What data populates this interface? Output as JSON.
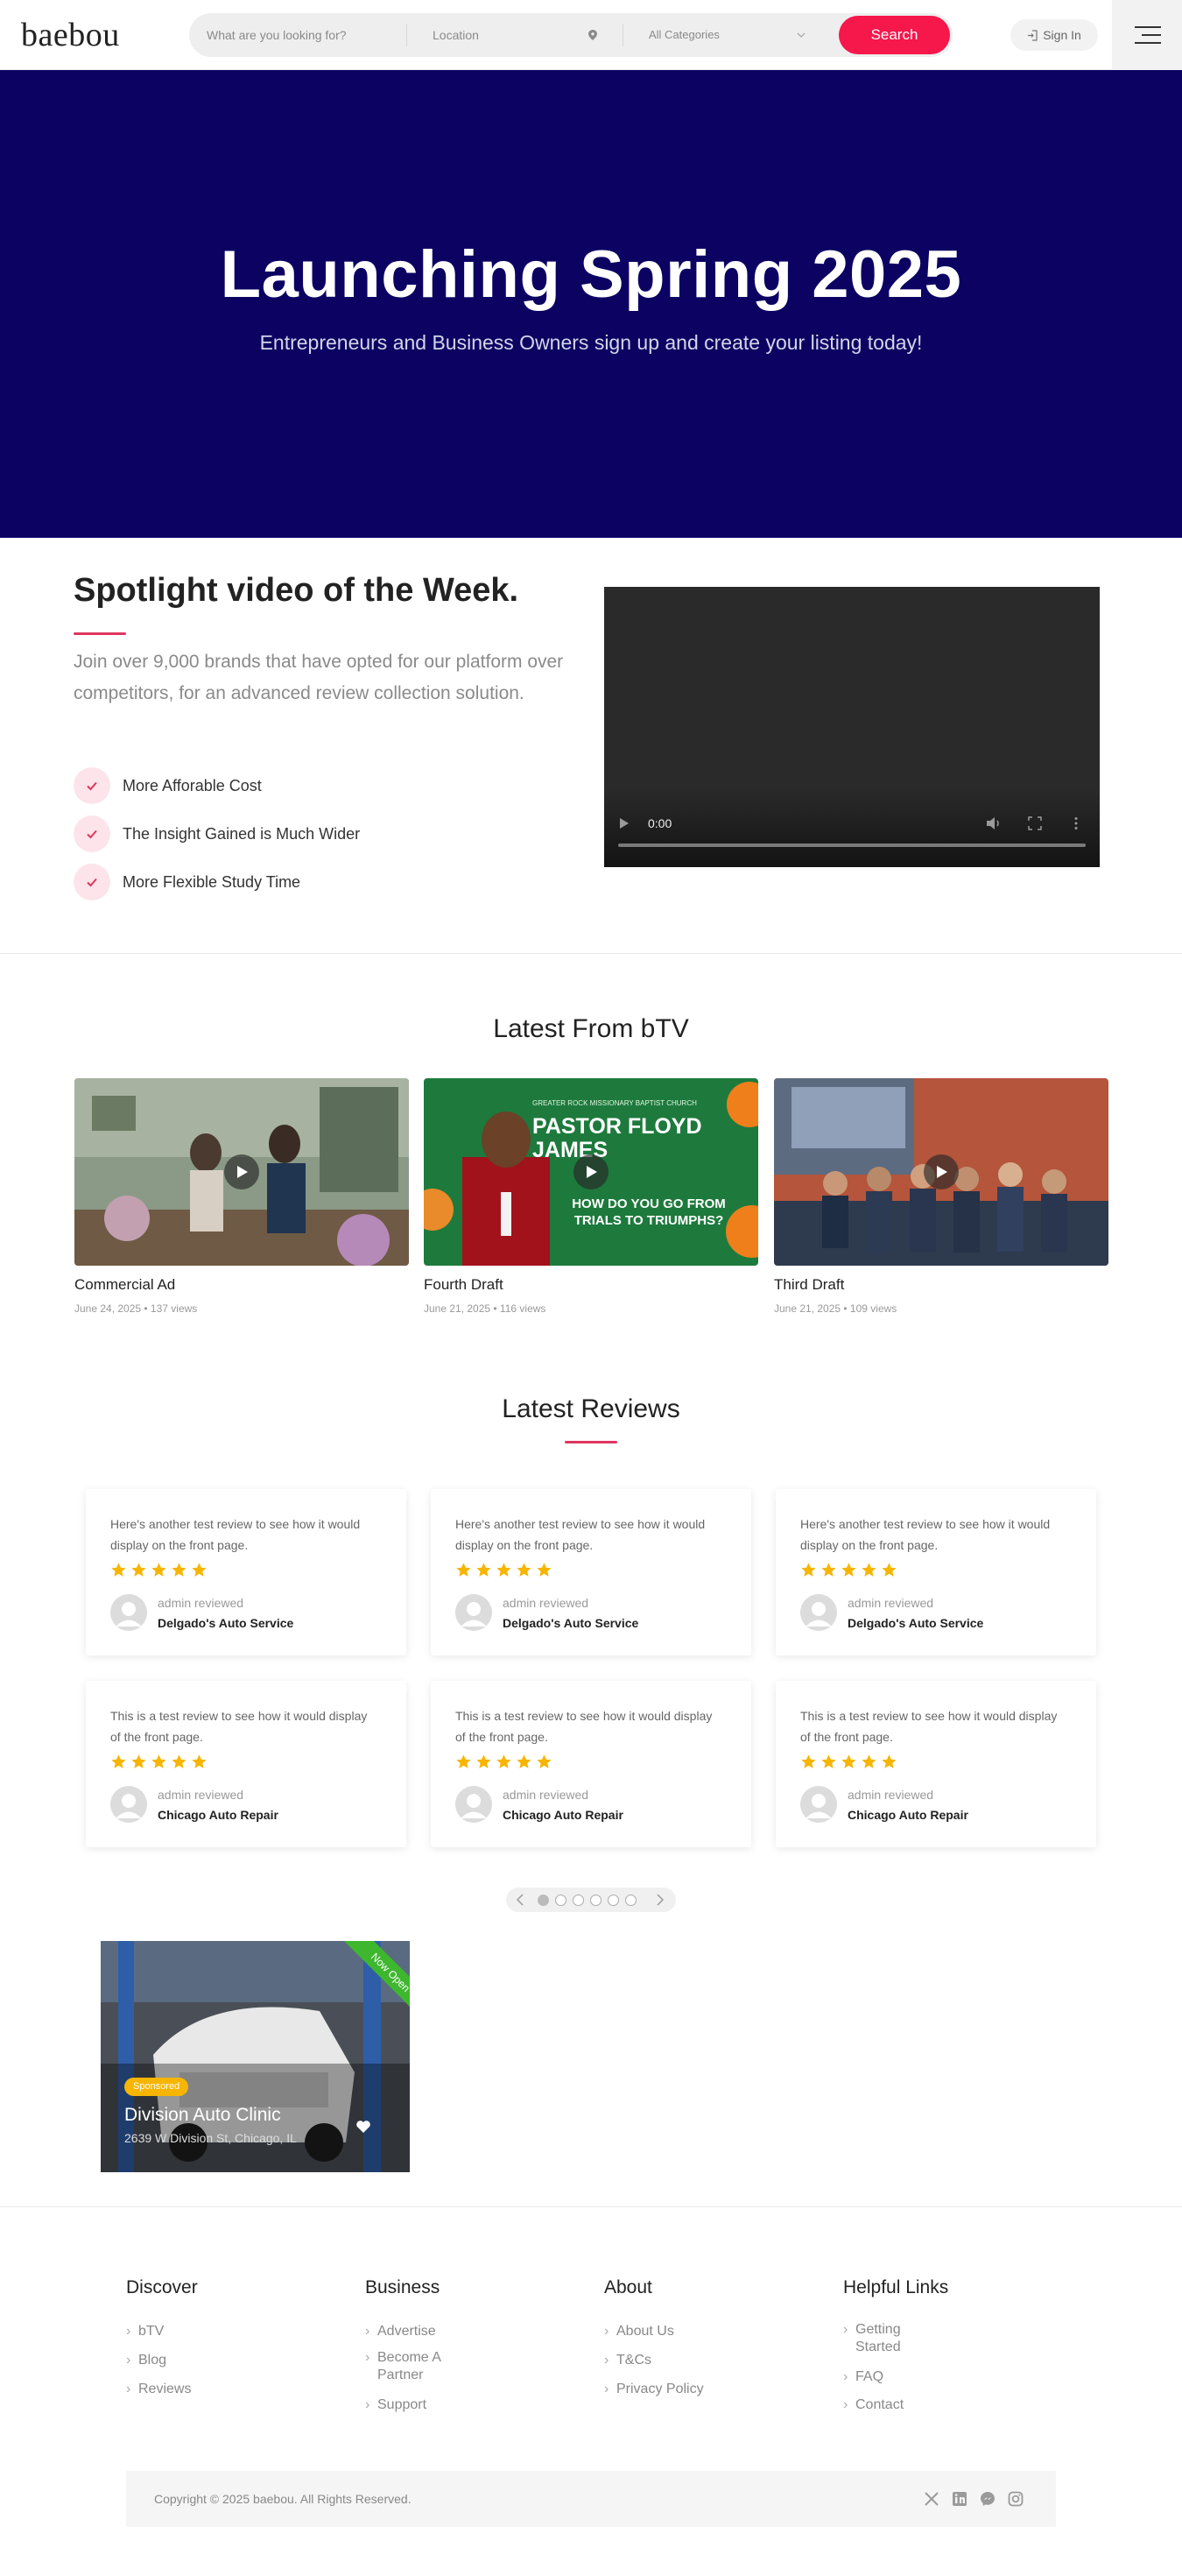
{
  "header": {
    "logo": "baebou",
    "search_placeholder": "What are you looking for?",
    "location_placeholder": "Location",
    "category_selected": "All Categories",
    "search_label": "Search",
    "signin_label": "Sign In"
  },
  "hero": {
    "title": "Launching Spring 2025",
    "subtitle": "Entrepreneurs and Business Owners sign up and create your listing today!",
    "background": "#0b0262"
  },
  "spotlight": {
    "title": "Spotlight video of the Week.",
    "description": "Join over 9,000 brands that have opted for our platform over competitors, for an advanced review collection solution.",
    "features": [
      "More Afforable Cost",
      "The Insight Gained is Much Wider",
      "More Flexible Study Time"
    ],
    "video_time": "0:00"
  },
  "btv": {
    "title": "Latest From bTV",
    "videos": [
      {
        "title": "Commercial Ad",
        "meta": "June 24, 2025 • 137 views"
      },
      {
        "title": "Fourth Draft",
        "meta": "June 21, 2025 • 116 views",
        "thumb_caption_top": "GREATER ROCK MISSIONARY BAPTIST CHURCH",
        "thumb_caption_name": "PASTOR FLOYD JAMES",
        "thumb_caption_bottom": "HOW DO YOU GO FROM TRIALS TO TRIUMPHS?"
      },
      {
        "title": "Third Draft",
        "meta": "June 21, 2025 • 109 views"
      }
    ]
  },
  "reviews": {
    "title": "Latest Reviews",
    "items": [
      {
        "text": "Here's another test review to see how it would display on the front page.",
        "by": "admin reviewed",
        "business": "Delgado's Auto Service",
        "rating": 5
      },
      {
        "text": "Here's another test review to see how it would display on the front page.",
        "by": "admin reviewed",
        "business": "Delgado's Auto Service",
        "rating": 5
      },
      {
        "text": "Here's another test review to see how it would display on the front page.",
        "by": "admin reviewed",
        "business": "Delgado's Auto Service",
        "rating": 5
      },
      {
        "text": "This is a test review to see how it would display of the front page.",
        "by": "admin reviewed",
        "business": "Chicago Auto Repair",
        "rating": 5
      },
      {
        "text": "This is a test review to see how it would display of the front page.",
        "by": "admin reviewed",
        "business": "Chicago Auto Repair",
        "rating": 5
      },
      {
        "text": "This is a test review to see how it would display of the front page.",
        "by": "admin reviewed",
        "business": "Chicago Auto Repair",
        "rating": 5
      }
    ],
    "pager_pages": 6,
    "pager_active": 1
  },
  "listing": {
    "ribbon": "Now Open",
    "badge": "Sponsored",
    "name": "Division Auto Clinic",
    "address": "2639 W Division St, Chicago, IL"
  },
  "footer": {
    "columns": [
      {
        "heading": "Discover",
        "links": [
          "bTV",
          "Blog",
          "Reviews"
        ]
      },
      {
        "heading": "Business",
        "links": [
          "Advertise",
          "Become A Partner",
          "Support"
        ]
      },
      {
        "heading": "About",
        "links": [
          "About Us",
          "T&Cs",
          "Privacy Policy"
        ]
      },
      {
        "heading": "Helpful Links",
        "links": [
          "Getting Started",
          "FAQ",
          "Contact"
        ]
      }
    ],
    "copyright": "Copyright © 2025 baebou. All Rights Reserved.",
    "social_icons": [
      "x-icon",
      "linkedin-icon",
      "messenger-icon",
      "instagram-icon"
    ]
  },
  "colors": {
    "accent": "#f6174b",
    "hero": "#0b0262",
    "star": "#f7b500",
    "ribbon": "#3eb72e"
  }
}
